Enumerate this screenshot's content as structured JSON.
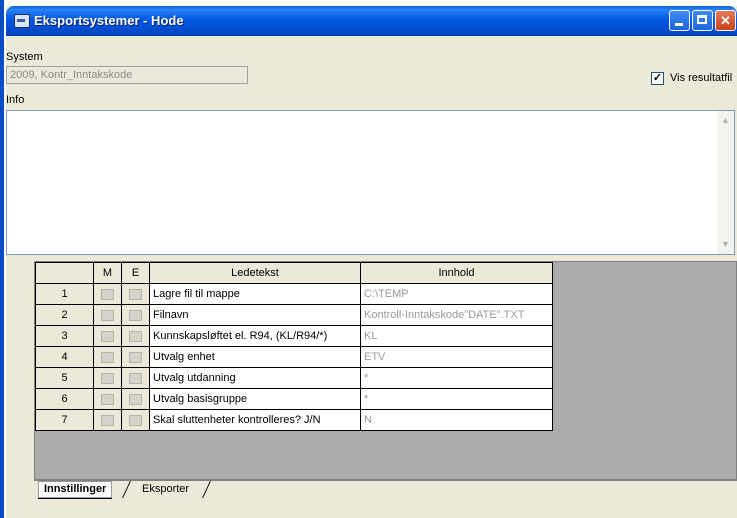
{
  "window": {
    "title": "Eksportsystemer - Hode"
  },
  "system": {
    "label": "System",
    "value": "2009, Kontr_Inntakskode"
  },
  "info": {
    "label": "Info"
  },
  "vis_resultatfil": {
    "label": "Vis resultatfil",
    "checked": true
  },
  "grid": {
    "headers": [
      "",
      "M",
      "E",
      "Ledetekst",
      "Innhold"
    ],
    "rows": [
      {
        "nr": "1",
        "ledetekst": "Lagre fil til mappe",
        "innhold": "C:\\TEMP"
      },
      {
        "nr": "2",
        "ledetekst": "Filnavn",
        "innhold": "Kontroll-Inntakskode\"DATE\".TXT"
      },
      {
        "nr": "3",
        "ledetekst": "Kunnskapsløftet el. R94, (KL/R94/*)",
        "innhold": "KL"
      },
      {
        "nr": "4",
        "ledetekst": "Utvalg enhet",
        "innhold": "ETV"
      },
      {
        "nr": "5",
        "ledetekst": "Utvalg utdanning",
        "innhold": "*"
      },
      {
        "nr": "6",
        "ledetekst": "Utvalg basisgruppe",
        "innhold": "*"
      },
      {
        "nr": "7",
        "ledetekst": "Skal sluttenheter kontrolleres? J/N",
        "innhold": "N"
      }
    ]
  },
  "tabs": [
    {
      "label": "Innstillinger",
      "active": true
    },
    {
      "label": "Eksporter",
      "active": false
    }
  ],
  "icons": {
    "app": "app-window-icon",
    "minimize": "minimize-icon",
    "maximize": "maximize-icon",
    "close": "close-icon",
    "scroll_up": "scroll-up-arrow-icon",
    "scroll_down": "scroll-down-arrow-icon"
  },
  "colors": {
    "titlebar": "#0058e6",
    "close_button": "#c8411b",
    "grid_background": "#ababab",
    "disabled_text": "#9a9a9a"
  }
}
